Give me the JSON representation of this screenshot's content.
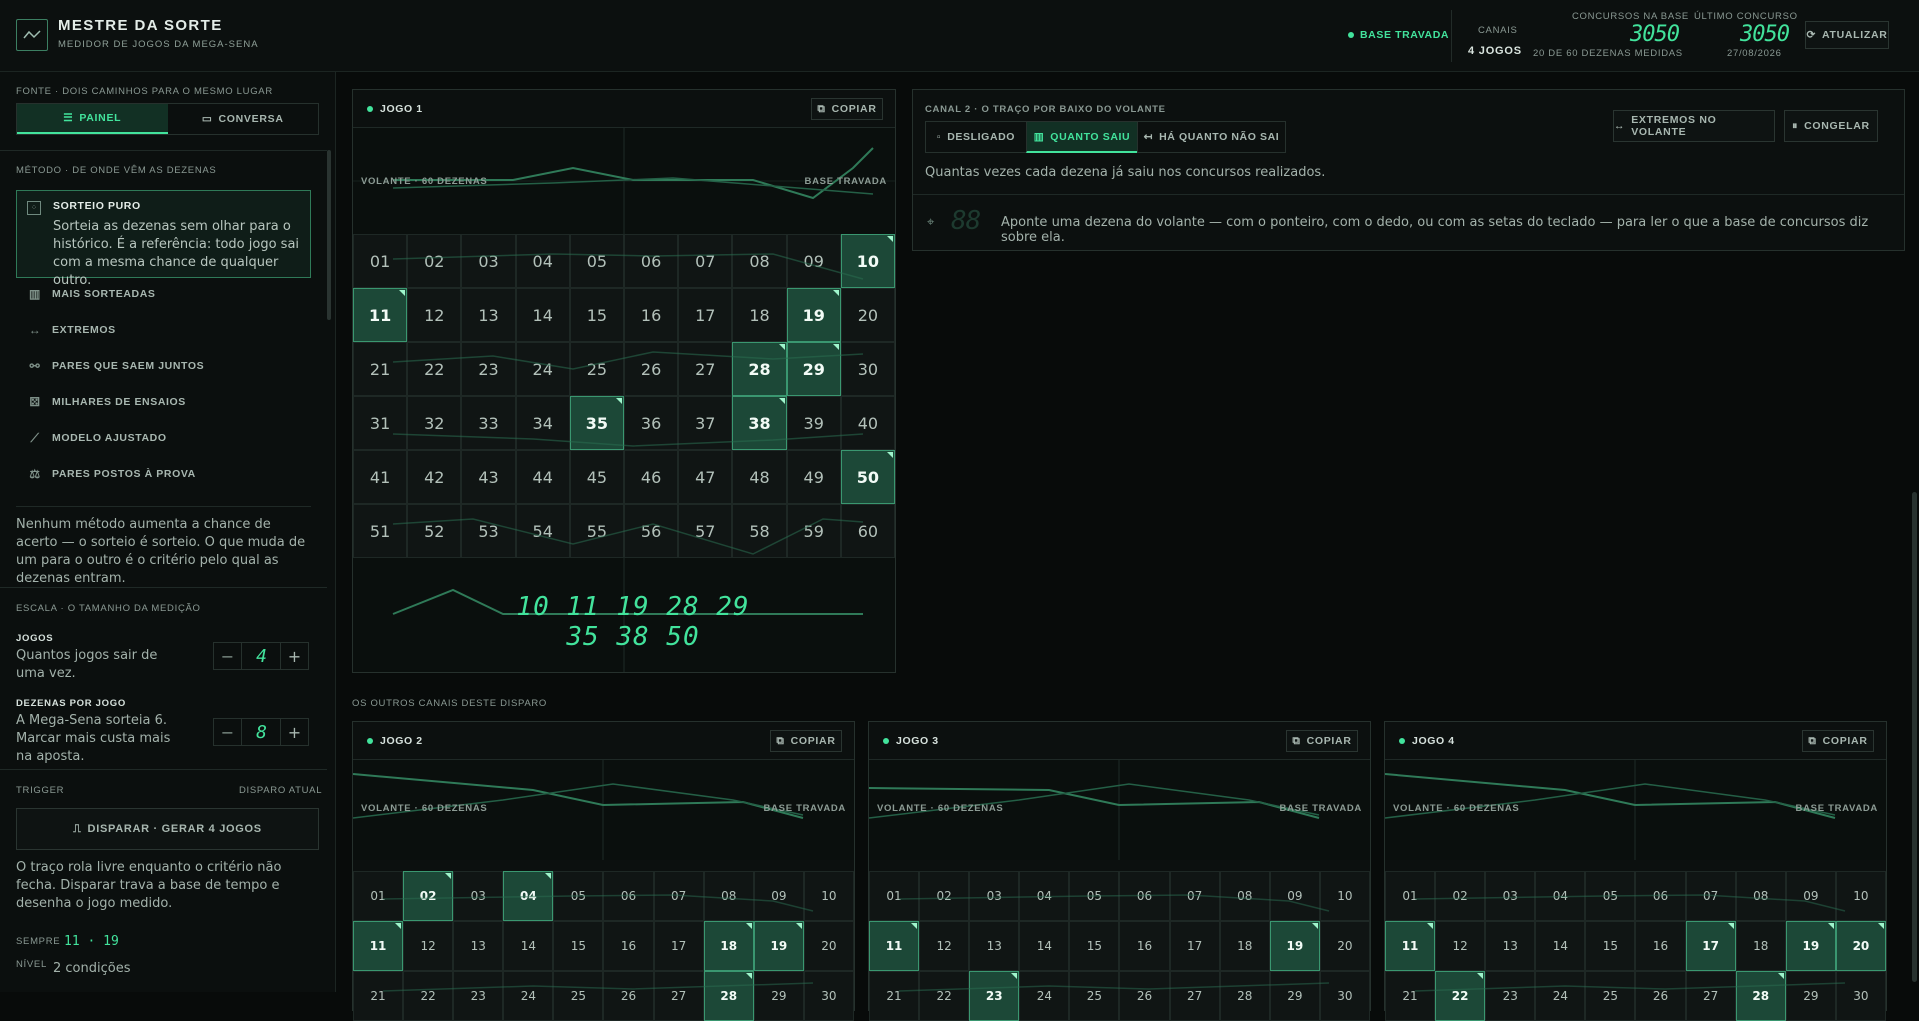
{
  "header": {
    "title": "MESTRE DA SORTE",
    "subtitle": "MEDIDOR DE JOGOS DA MEGA-SENA",
    "status": "BASE TRAVADA",
    "canais_label": "CANAIS",
    "canais_value": "4 JOGOS",
    "concursos_label": "CONCURSOS NA BASE",
    "concursos_value": "3050",
    "concursos_note": "20 DE 60 DEZENAS MEDIDAS",
    "ultimo_label": "ÚLTIMO CONCURSO",
    "ultimo_value": "3050",
    "ultimo_date": "27/08/2026",
    "refresh_label": "ATUALIZAR"
  },
  "sidebar": {
    "fonte_label": "FONTE · DOIS CAMINHOS PARA O MESMO LUGAR",
    "tabs": [
      "PAINEL",
      "CONVERSA"
    ],
    "metodo_label": "MÉTODO · DE ONDE VÊM AS DEZENAS",
    "selected_method": {
      "name": "SORTEIO PURO",
      "desc": "Sorteia as dezenas sem olhar para o histórico. É a referência: todo jogo sai com a mesma chance de qualquer outro."
    },
    "methods": [
      "MAIS SORTEADAS",
      "EXTREMOS",
      "PARES QUE SAEM JUNTOS",
      "MILHARES DE ENSAIOS",
      "MODELO AJUSTADO",
      "PARES POSTOS À PROVA"
    ],
    "note": "Nenhum método aumenta a chance de acerto — o sorteio é sorteio. O que muda de um para o outro é o critério pelo qual as dezenas entram.",
    "escala_label": "ESCALA · O TAMANHO DA MEDIÇÃO",
    "jogos": {
      "label": "JOGOS",
      "desc": "Quantos jogos sair de uma vez.",
      "value": "4"
    },
    "dezenas": {
      "label": "DEZENAS POR JOGO",
      "desc": "A Mega-Sena sorteia 6. Marcar mais custa mais na aposta.",
      "value": "8"
    },
    "trigger_label": "TRIGGER",
    "disparo_label": "DISPARO ATUAL",
    "fire_button": "DISPARAR · GERAR 4 JOGOS",
    "trigger_note": "O traço rola livre enquanto o critério não fecha. Disparar trava a base de tempo e desenha o jogo medido.",
    "sempre_label": "SEMPRE",
    "sempre_value": "11 · 19",
    "nivel_label": "NÍVEL",
    "nivel_value": "2 condições"
  },
  "jogo1": {
    "title": "JOGO 1",
    "copy": "COPIAR",
    "volante_label": "VOLANTE · 60 DEZENAS",
    "base_label": "BASE TRAVADA",
    "selected": [
      10,
      11,
      19,
      28,
      29,
      35,
      38,
      50
    ],
    "readout": "10 11 19 28 29 35 38 50"
  },
  "canal2": {
    "label": "CANAL 2 · O TRAÇO POR BAIXO DO VOLANTE",
    "modes": [
      "DESLIGADO",
      "QUANTO SAIU",
      "HÁ QUANTO NÃO SAI"
    ],
    "active_mode": "QUANTO SAIU",
    "extremos_button": "EXTREMOS NO VOLANTE",
    "congelar_button": "CONGELAR",
    "desc": "Quantas vezes cada dezena já saiu nos concursos realizados.",
    "readout": "88",
    "hint": "Aponte uma dezena do volante — com o ponteiro, com o dedo, ou com as setas do teclado — para ler o que a base de concursos diz sobre ela."
  },
  "outros_label": "OS OUTROS CANAIS DESTE DISPARO",
  "jogos_menores": [
    {
      "title": "JOGO 2",
      "copy": "COPIAR",
      "volante_label": "VOLANTE · 60 DEZENAS",
      "base_label": "BASE TRAVADA",
      "selected": [
        2,
        4,
        11,
        18,
        19,
        28
      ]
    },
    {
      "title": "JOGO 3",
      "copy": "COPIAR",
      "volante_label": "VOLANTE · 60 DEZENAS",
      "base_label": "BASE TRAVADA",
      "selected": [
        11,
        19,
        23
      ]
    },
    {
      "title": "JOGO 4",
      "copy": "COPIAR",
      "volante_label": "VOLANTE · 60 DEZENAS",
      "base_label": "BASE TRAVADA",
      "selected": [
        11,
        17,
        19,
        20,
        22,
        28
      ]
    }
  ]
}
